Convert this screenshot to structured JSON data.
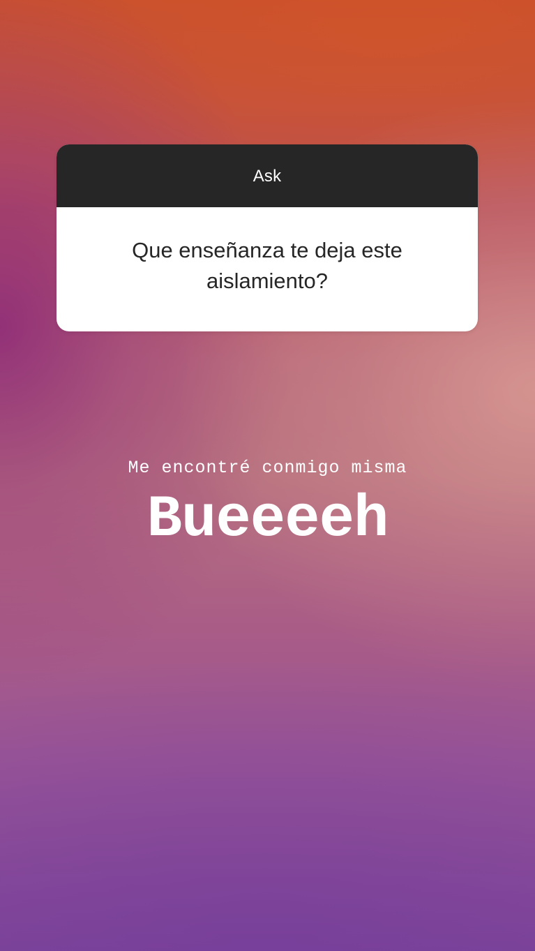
{
  "colors": {
    "background_top": "#c8502f",
    "background_middle": "#b7717f",
    "background_bottom": "#7f459a",
    "card_header": "#262626",
    "card_body": "#ffffff",
    "text_light": "#ffffff",
    "text_dark": "#262626"
  },
  "question_sticker": {
    "header_label": "Ask",
    "question": "Que enseñanza te deja este aislamiento?"
  },
  "answer": {
    "line_small": "Me encontré conmigo misma",
    "line_big": "Bueeeeh"
  }
}
